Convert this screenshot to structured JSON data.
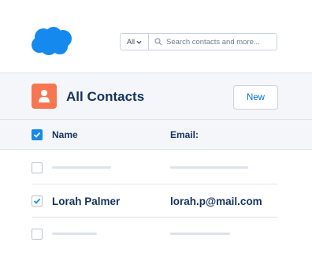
{
  "search": {
    "scope": "All",
    "placeholder": "Search contacts and more..."
  },
  "header": {
    "title": "All Contacts",
    "new_label": "New"
  },
  "table": {
    "columns": [
      "Name",
      "Email:"
    ],
    "rows": [
      {
        "name": "",
        "email": "",
        "checked": false
      },
      {
        "name": "Lorah Palmer",
        "email": "lorah.p@mail.com",
        "checked": true
      },
      {
        "name": "",
        "email": "",
        "checked": false
      }
    ]
  },
  "colors": {
    "brand_cloud": "#1589ee",
    "contact_icon": "#f77651",
    "link": "#0070d2",
    "text": "#16325c"
  },
  "icons": [
    "salesforce-cloud-logo",
    "chevron-down-icon",
    "search-icon",
    "contact-person-icon",
    "checkmark-icon"
  ]
}
